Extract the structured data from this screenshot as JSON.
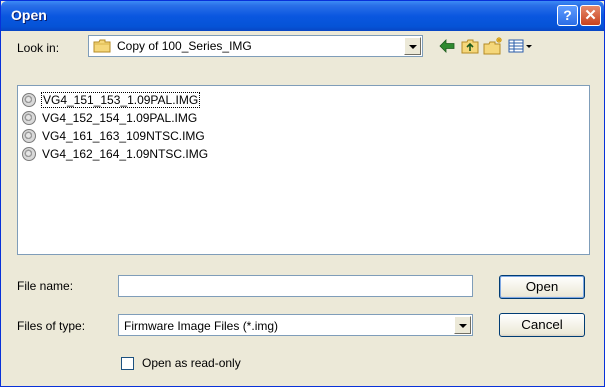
{
  "window": {
    "title": "Open",
    "help_button": "?",
    "close_button": "✕"
  },
  "lookin": {
    "label": "Look in:",
    "value": "Copy of 100_Series_IMG"
  },
  "toolbar": {
    "icons": [
      "back-arrow-icon",
      "up-one-level-icon",
      "create-new-folder-icon",
      "view-menu-icon"
    ]
  },
  "files": [
    {
      "name": "VG4_151_153_1.09PAL.IMG",
      "focused": true
    },
    {
      "name": "VG4_152_154_1.09PAL.IMG",
      "focused": false
    },
    {
      "name": "VG4_161_163_109NTSC.IMG",
      "focused": false
    },
    {
      "name": "VG4_162_164_1.09NTSC.IMG",
      "focused": false
    }
  ],
  "filename": {
    "label": "File name:",
    "value": ""
  },
  "filetype": {
    "label": "Files of type:",
    "value": "Firmware Image Files (*.img)"
  },
  "buttons": {
    "open": "Open",
    "cancel": "Cancel"
  },
  "readonly": {
    "label": "Open as read-only",
    "checked": false
  },
  "colors": {
    "titlebar": "#0a57e0",
    "dialog_bg": "#ece9d8",
    "field_border": "#7f9db9"
  }
}
